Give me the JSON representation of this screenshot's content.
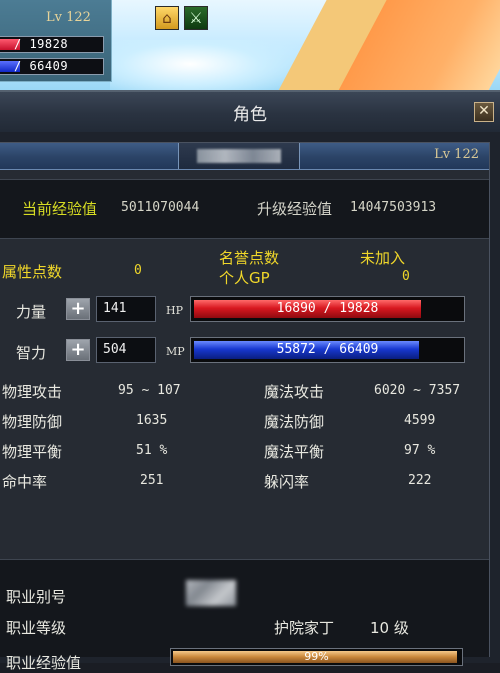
{
  "hud": {
    "level": "Lv 122",
    "hp": "19828",
    "hp_fraction": 0.19,
    "mp": "66409",
    "mp_fraction": 0.19,
    "icons": [
      "house-icon",
      "sword-icon"
    ]
  },
  "window": {
    "title": "角色",
    "close_label": "✕"
  },
  "character": {
    "level": "Lv 122",
    "current_exp_label": "当前经验值",
    "current_exp": "5011070044",
    "next_exp_label": "升级经验值",
    "next_exp": "14047503913"
  },
  "points": {
    "attr_label": "属性点数",
    "attr_value": "0",
    "honor_label": "名誉点数",
    "personal_gp_label": "个人GP",
    "honor_status": "未加入",
    "personal_gp": "0"
  },
  "stats": {
    "strength_label": "力量",
    "strength": "141",
    "intelligence_label": "智力",
    "intelligence": "504",
    "plus_label": "+"
  },
  "bars": {
    "hp_tag": "HP",
    "hp_text": "16890 / 19828",
    "hp_fraction": 0.852,
    "mp_tag": "MP",
    "mp_text": "55872 / 66409",
    "mp_fraction": 0.841
  },
  "combat": {
    "rows": [
      {
        "l": "物理攻击",
        "lv": "95 ~ 107",
        "r": "魔法攻击",
        "rv": "6020 ~ 7357"
      },
      {
        "l": "物理防御",
        "lv": "1635",
        "r": "魔法防御",
        "rv": "4599"
      },
      {
        "l": "物理平衡",
        "lv": "51 %",
        "r": "魔法平衡",
        "rv": "97 %"
      },
      {
        "l": "命中率",
        "lv": "251",
        "r": "躲闪率",
        "rv": "222"
      }
    ]
  },
  "job": {
    "alias_label": "职业别号",
    "level_label": "职业等级",
    "job_name": "护院家丁",
    "job_level": "10 级",
    "exp_label": "职业经验值",
    "exp_text": "99%",
    "exp_fraction": 0.99
  },
  "colors": {
    "accent_yellow": "#f0d72a",
    "hp_red": "#d81820",
    "mp_blue": "#1838d0",
    "exp_orange": "#c9873a"
  }
}
